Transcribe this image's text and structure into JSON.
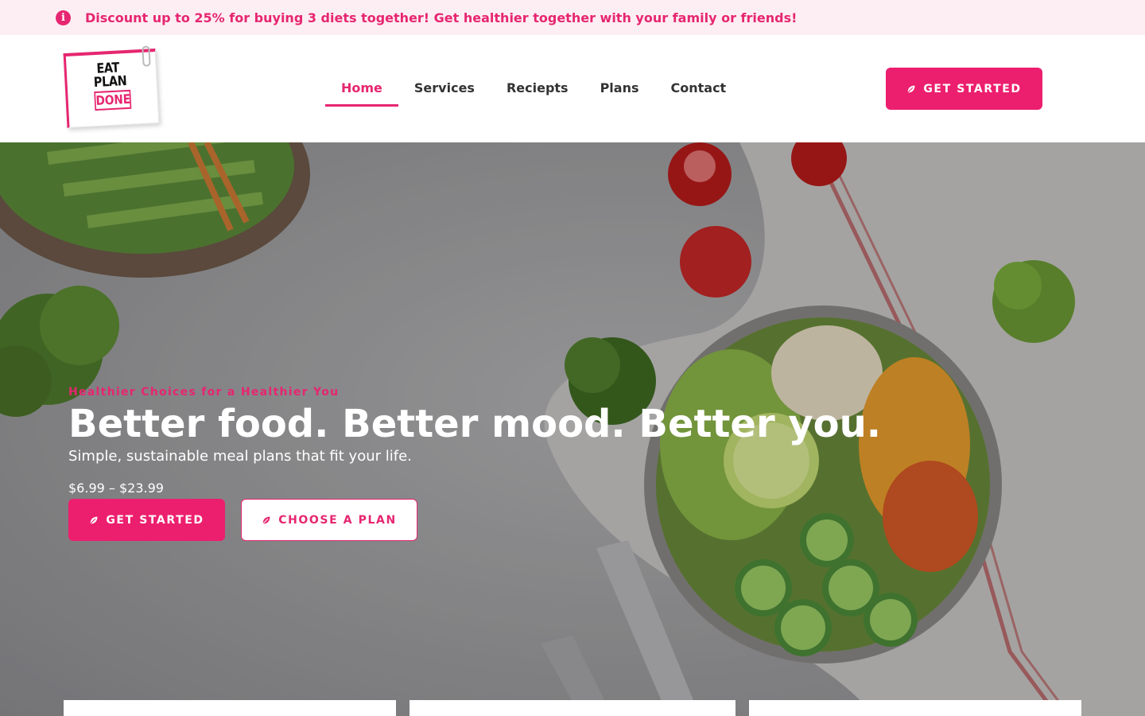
{
  "announcement": {
    "icon": "info-icon",
    "text": "Discount up to 25% for buying 3 diets together! Get healthier together with your family or friends!"
  },
  "logo": {
    "line1": "EAT",
    "line2": "PLAN",
    "line3": "DONE"
  },
  "nav": {
    "items": [
      {
        "label": "Home",
        "active": true
      },
      {
        "label": "Services"
      },
      {
        "label": "Reciepts"
      },
      {
        "label": "Plans"
      },
      {
        "label": "Contact"
      }
    ]
  },
  "header": {
    "cta_label": "GET STARTED",
    "cta_icon": "leaf-icon"
  },
  "hero": {
    "eyebrow": "Healthier Choices for a Healthier You",
    "headline": "Better food. Better mood. Better you.",
    "subline": "Simple, sustainable meal plans that fit your life.",
    "price": "$6.99 – $23.99",
    "primary_label": "GET STARTED",
    "secondary_label": "CHOOSE A PLAN"
  },
  "colors": {
    "accent": "#ec1f6e",
    "accent_text": "#e62670",
    "announce_bg": "#fdeef3"
  }
}
